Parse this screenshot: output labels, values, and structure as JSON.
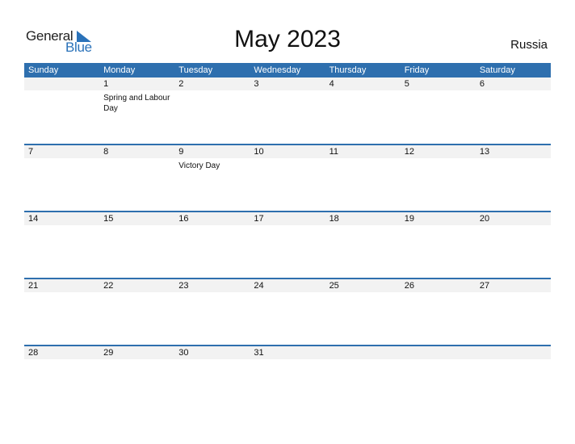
{
  "logo": {
    "text_general": "General",
    "text_blue": "Blue"
  },
  "title": "May 2023",
  "country": "Russia",
  "colors": {
    "header_bg": "#2e6fae",
    "accent": "#2a72b9",
    "daynum_bg": "#f2f2f2"
  },
  "weekdays": [
    "Sunday",
    "Monday",
    "Tuesday",
    "Wednesday",
    "Thursday",
    "Friday",
    "Saturday"
  ],
  "weeks": [
    [
      {
        "num": ""
      },
      {
        "num": "1",
        "holiday": "Spring and Labour Day"
      },
      {
        "num": "2"
      },
      {
        "num": "3"
      },
      {
        "num": "4"
      },
      {
        "num": "5"
      },
      {
        "num": "6"
      }
    ],
    [
      {
        "num": "7"
      },
      {
        "num": "8"
      },
      {
        "num": "9",
        "holiday": "Victory Day"
      },
      {
        "num": "10"
      },
      {
        "num": "11"
      },
      {
        "num": "12"
      },
      {
        "num": "13"
      }
    ],
    [
      {
        "num": "14"
      },
      {
        "num": "15"
      },
      {
        "num": "16"
      },
      {
        "num": "17"
      },
      {
        "num": "18"
      },
      {
        "num": "19"
      },
      {
        "num": "20"
      }
    ],
    [
      {
        "num": "21"
      },
      {
        "num": "22"
      },
      {
        "num": "23"
      },
      {
        "num": "24"
      },
      {
        "num": "25"
      },
      {
        "num": "26"
      },
      {
        "num": "27"
      }
    ],
    [
      {
        "num": "28"
      },
      {
        "num": "29"
      },
      {
        "num": "30"
      },
      {
        "num": "31"
      },
      {
        "num": ""
      },
      {
        "num": ""
      },
      {
        "num": ""
      }
    ]
  ]
}
